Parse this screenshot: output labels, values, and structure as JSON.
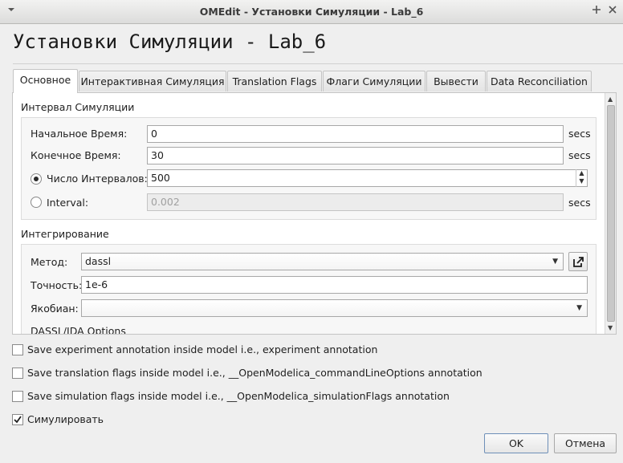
{
  "window": {
    "title": "OMEdit - Установки Симуляции - Lab_6",
    "menu_icon": "chevron-down-icon",
    "pin_icon": "pin-icon",
    "close_icon": "close-icon"
  },
  "heading": "Установки Симуляции - Lab_6",
  "tabs": [
    {
      "label": "Основное",
      "active": true
    },
    {
      "label": "Интерактивная Симуляция",
      "active": false
    },
    {
      "label": "Translation Flags",
      "active": false
    },
    {
      "label": "Флаги Симуляции",
      "active": false
    },
    {
      "label": "Вывести",
      "active": false
    },
    {
      "label": "Data Reconciliation",
      "active": false
    }
  ],
  "interval": {
    "title": "Интервал Симуляции",
    "start_label": "Начальное Время:",
    "start_value": "0",
    "stop_label": "Конечное Время:",
    "stop_value": "30",
    "num_intervals_label": "Число Интервалов:",
    "num_intervals_value": "500",
    "interval_label": "Interval:",
    "interval_value": "0.002",
    "unit": "secs",
    "mode_selected": "num_intervals"
  },
  "integration": {
    "title": "Интегрирование",
    "method_label": "Метод:",
    "method_value": "dassl",
    "tolerance_label": "Точность:",
    "tolerance_value": "1e-6",
    "jacobian_label": "Якобиан:",
    "jacobian_value": "",
    "options_title": "DASSL/IDA Options"
  },
  "checkboxes": [
    {
      "label": "Save experiment annotation inside model i.e., experiment annotation",
      "checked": false
    },
    {
      "label": "Save translation flags inside model i.e., __OpenModelica_commandLineOptions annotation",
      "checked": false
    },
    {
      "label": "Save simulation flags inside model i.e., __OpenModelica_simulationFlags annotation",
      "checked": false
    },
    {
      "label": "Симулировать",
      "checked": true
    }
  ],
  "buttons": {
    "ok": "OK",
    "cancel": "Отмена"
  },
  "colors": {
    "default_button_border": "#6e8fb8",
    "tab_pane_bg": "#ffffff"
  }
}
